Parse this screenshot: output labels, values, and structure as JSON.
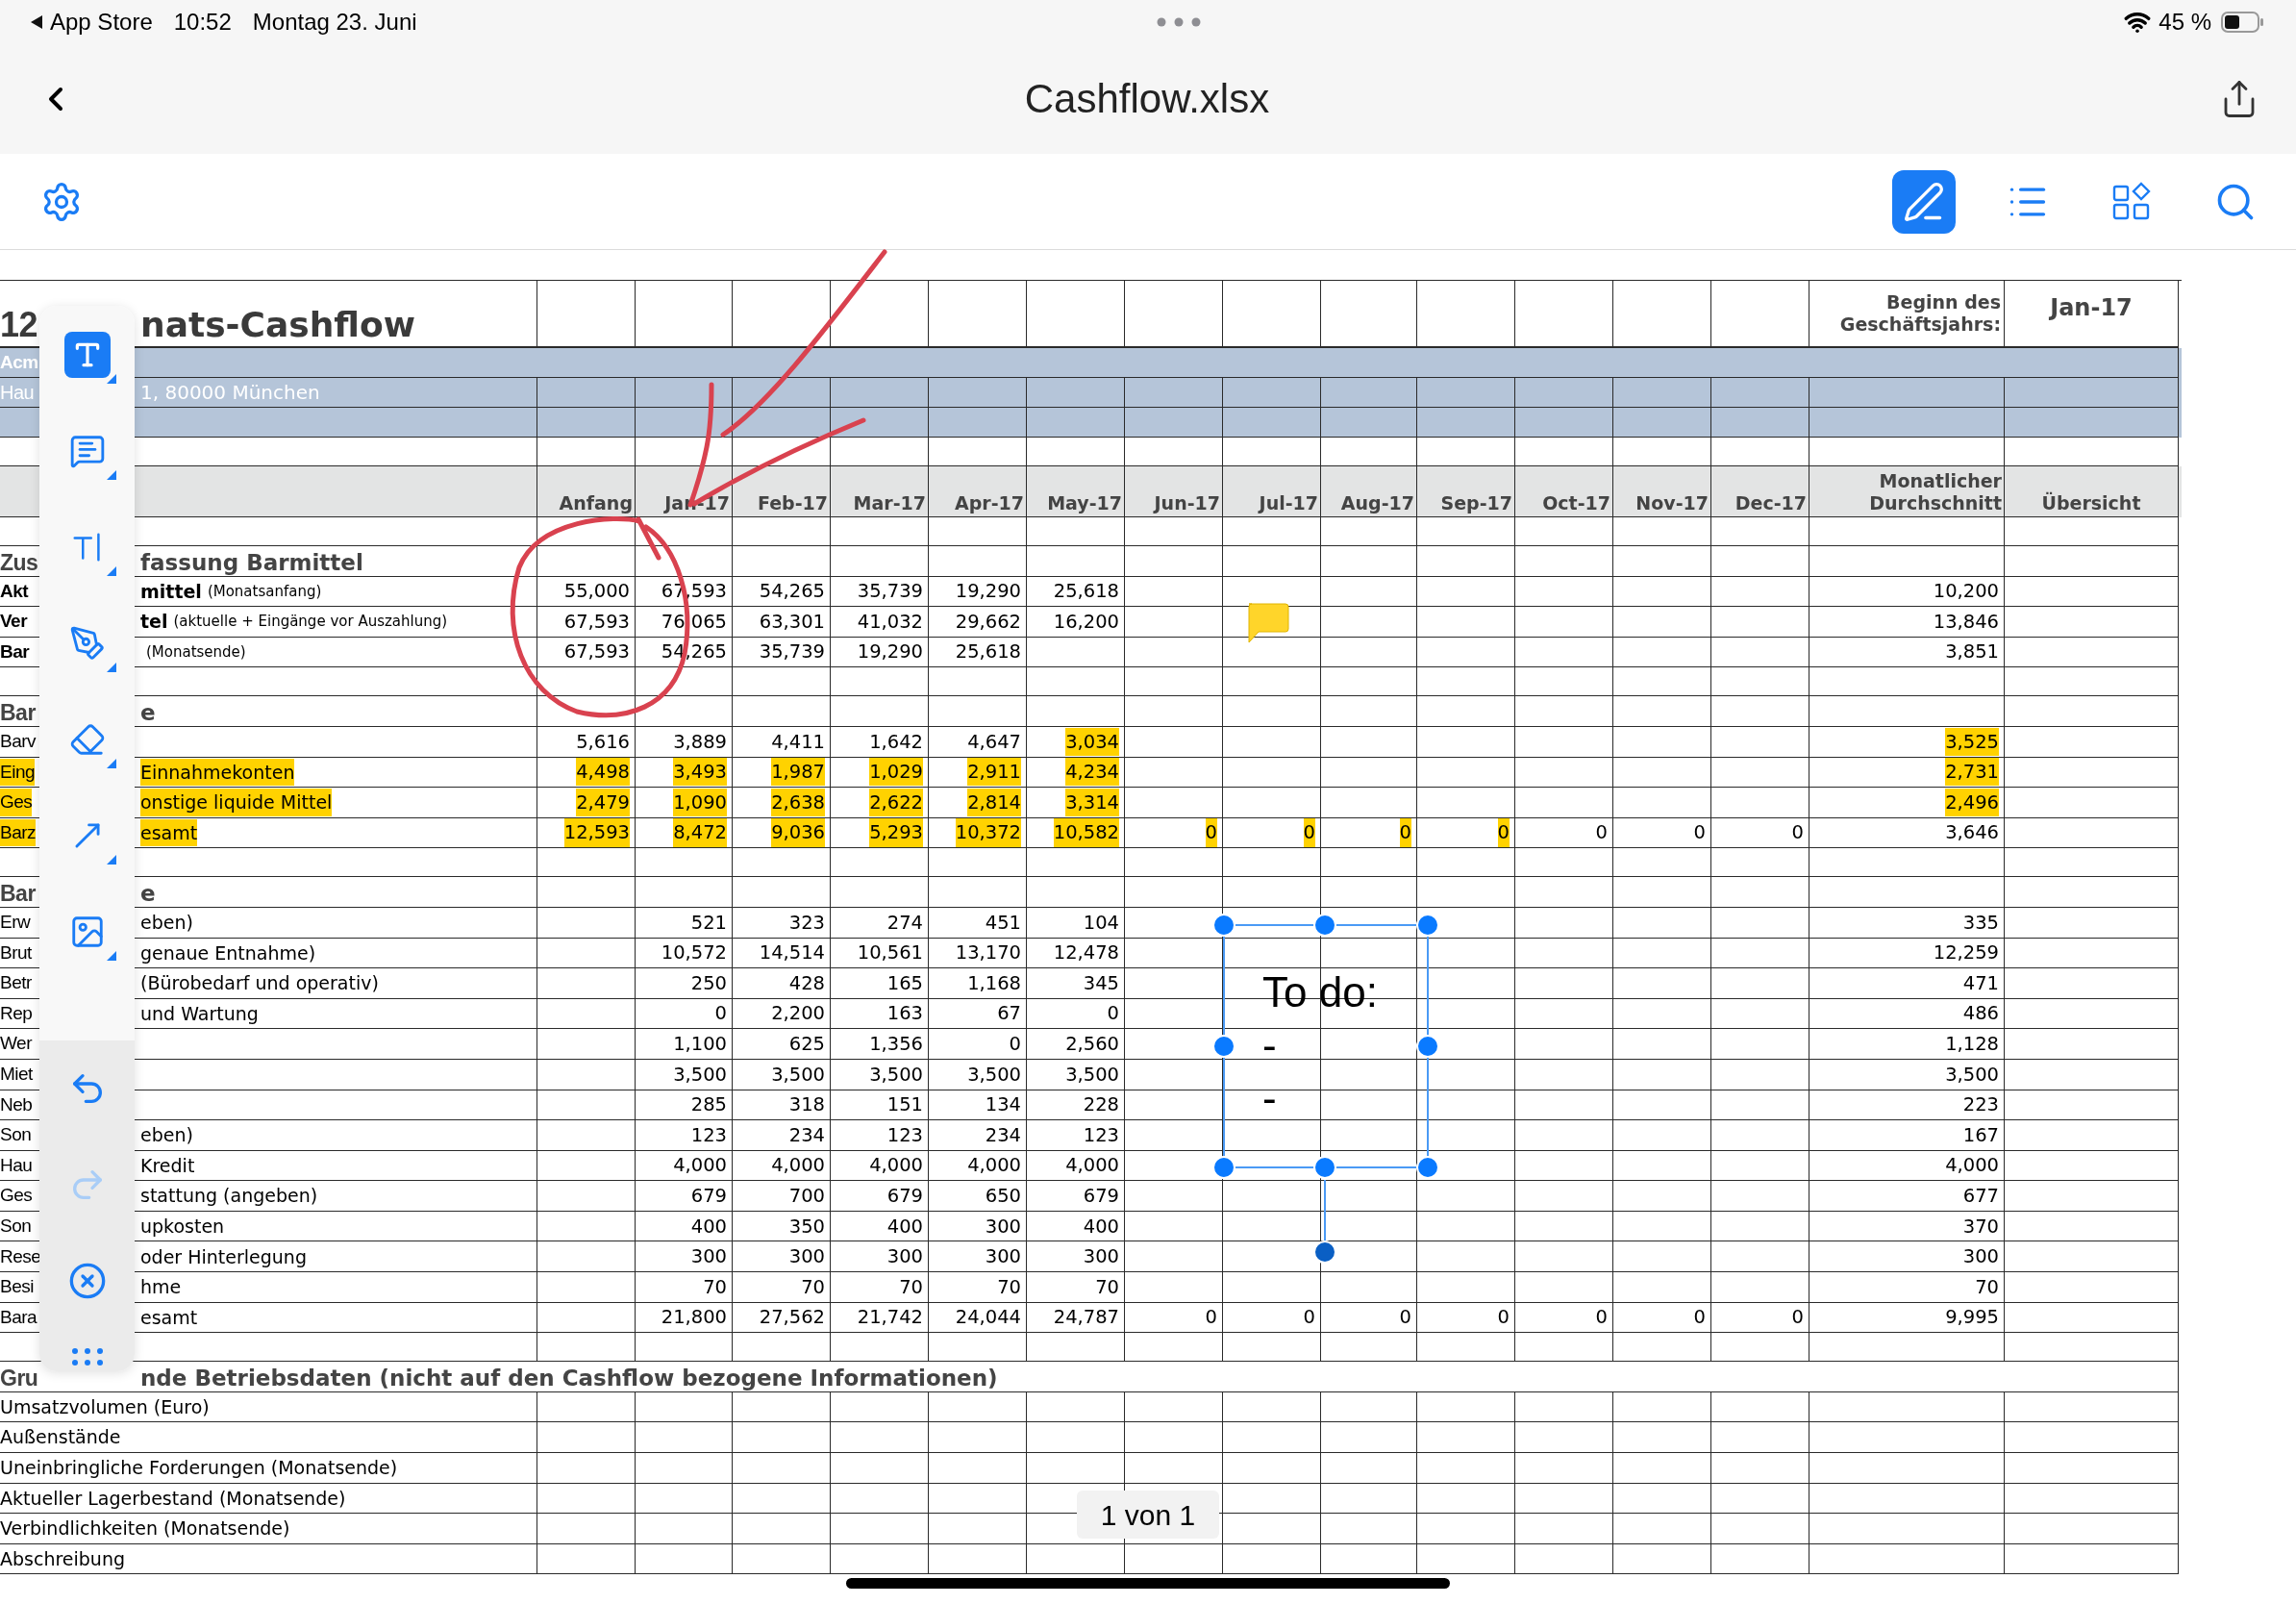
{
  "status_bar": {
    "app": "App Store",
    "time": "10:52",
    "date": "Montag 23. Juni",
    "battery": "45 %"
  },
  "nav": {
    "title": "Cashflow.xlsx"
  },
  "view_tools": [
    {
      "kind": "markup",
      "selected": true
    },
    {
      "kind": "outline",
      "selected": false
    },
    {
      "kind": "thumbnails",
      "selected": false
    },
    {
      "kind": "search",
      "selected": false
    }
  ],
  "annotation_tools": [
    {
      "kind": "text",
      "selected": true
    },
    {
      "kind": "comment",
      "selected": false
    },
    {
      "kind": "text_cursor",
      "selected": false
    },
    {
      "kind": "pen",
      "selected": false
    },
    {
      "kind": "eraser",
      "selected": false
    },
    {
      "kind": "arrow",
      "selected": false
    },
    {
      "kind": "image",
      "selected": false
    }
  ],
  "toolbar_actions": [
    {
      "kind": "undo",
      "disabled": false
    },
    {
      "kind": "redo",
      "disabled": true
    },
    {
      "kind": "close",
      "disabled": false
    },
    {
      "kind": "more",
      "disabled": false
    }
  ],
  "sheet": {
    "rows": [
      {
        "kind": "title",
        "label_start": "12",
        "label_end": "nats-Cashflow",
        "fiscal_label": "Beginn des Geschäftsjahrs:",
        "fiscal_value": "Jan-17"
      },
      {
        "kind": "band_title",
        "label_start": "Acm"
      },
      {
        "kind": "band",
        "label_start": "Hau",
        "label_end": "1, 80000 München"
      },
      {
        "kind": "band"
      },
      {
        "kind": "blank"
      },
      {
        "kind": "header",
        "columns": [
          "Anfang",
          "Jan-17",
          "Feb-17",
          "Mar-17",
          "Apr-17",
          "May-17",
          "Jun-17",
          "Jul-17",
          "Aug-17",
          "Sep-17",
          "Oct-17",
          "Nov-17",
          "Dec-17",
          "Monatlicher Durchschnitt",
          "Übersicht"
        ]
      },
      {
        "kind": "blank"
      },
      {
        "kind": "section",
        "label_start": "Zus",
        "label_end": "fassung Barmittel"
      },
      {
        "kind": "summary",
        "label_start": "Akt",
        "label_end": "mittel",
        "label_note": "(Monatsanfang)",
        "label_highlighted": false,
        "anfang": "55,000",
        "months": [
          "67,593",
          "54,265",
          "35,739",
          "19,290",
          "25,618"
        ],
        "average": "10,200"
      },
      {
        "kind": "summary",
        "label_start": "Ver",
        "label_end": "tel",
        "label_note": "(aktuelle + Eingänge vor Auszahlung)",
        "label_highlighted": false,
        "anfang": "67,593",
        "months": [
          "76,065",
          "63,301",
          "41,032",
          "29,662",
          "16,200"
        ],
        "average": "13,846"
      },
      {
        "kind": "summary",
        "label_start": "Bar",
        "label_note": "(Monatsende)",
        "label_highlighted": false,
        "anfang": "67,593",
        "months": [
          "54,265",
          "35,739",
          "19,290",
          "25,618"
        ],
        "average": "3,851"
      },
      {
        "kind": "blank"
      },
      {
        "kind": "section",
        "label_start": "Bar",
        "label_end": "e"
      },
      {
        "kind": "data",
        "label_start": "Barv",
        "label_highlighted": false,
        "anfang": {
          "text": "5,616",
          "highlighted": false
        },
        "months": [
          {
            "text": "3,889",
            "highlighted": false
          },
          {
            "text": "4,411",
            "highlighted": false
          },
          {
            "text": "1,642",
            "highlighted": false
          },
          {
            "text": "4,647",
            "highlighted": false
          },
          {
            "text": "3,034",
            "highlighted": true
          }
        ],
        "average": {
          "text": "3,525",
          "highlighted": true
        }
      },
      {
        "kind": "data",
        "label_start": "Eing",
        "label_end": "Einnahmekonten",
        "label_highlighted": true,
        "anfang": {
          "text": "4,498",
          "highlighted": true
        },
        "months": [
          {
            "text": "3,493",
            "highlighted": true
          },
          {
            "text": "1,987",
            "highlighted": true
          },
          {
            "text": "1,029",
            "highlighted": true
          },
          {
            "text": "2,911",
            "highlighted": true
          },
          {
            "text": "4,234",
            "highlighted": true
          }
        ],
        "average": {
          "text": "2,731",
          "highlighted": true
        }
      },
      {
        "kind": "data",
        "label_start": "Ges",
        "label_end": "onstige liquide Mittel",
        "label_highlighted": true,
        "anfang": {
          "text": "2,479",
          "highlighted": true
        },
        "months": [
          {
            "text": "1,090",
            "highlighted": true
          },
          {
            "text": "2,638",
            "highlighted": true
          },
          {
            "text": "2,622",
            "highlighted": true
          },
          {
            "text": "2,814",
            "highlighted": true
          },
          {
            "text": "3,314",
            "highlighted": true
          }
        ],
        "average": {
          "text": "2,496",
          "highlighted": true
        }
      },
      {
        "kind": "data",
        "label_start": "Barz",
        "label_end": "esamt",
        "label_highlighted": true,
        "anfang": {
          "text": "12,593",
          "highlighted": true
        },
        "months": [
          {
            "text": "8,472",
            "highlighted": true
          },
          {
            "text": "9,036",
            "highlighted": true
          },
          {
            "text": "5,293",
            "highlighted": true
          },
          {
            "text": "10,372",
            "highlighted": true
          },
          {
            "text": "10,582",
            "highlighted": true
          },
          {
            "text": "0",
            "highlighted": true
          },
          {
            "text": "0",
            "highlighted": true
          },
          {
            "text": "0",
            "highlighted": true
          },
          {
            "text": "0",
            "highlighted": true
          },
          {
            "text": "0",
            "highlighted": false
          },
          {
            "text": "0",
            "highlighted": false
          },
          {
            "text": "0",
            "highlighted": false
          }
        ],
        "average": {
          "text": "3,646",
          "highlighted": false
        }
      },
      {
        "kind": "blank"
      },
      {
        "kind": "section",
        "label_start": "Bar",
        "label_end": "e"
      },
      {
        "kind": "data",
        "label_start": "Erw",
        "label_end": "eben)",
        "label_highlighted": false,
        "months": [
          "521",
          "323",
          "274",
          "451",
          "104"
        ],
        "average": "335"
      },
      {
        "kind": "data",
        "label_start": "Brut",
        "label_end": "genaue Entnahme)",
        "label_highlighted": false,
        "months": [
          "10,572",
          "14,514",
          "10,561",
          "13,170",
          "12,478"
        ],
        "average": "12,259"
      },
      {
        "kind": "data",
        "label_start": "Betr",
        "label_end": "(Bürobedarf und operativ)",
        "label_highlighted": false,
        "months": [
          "250",
          "428",
          "165",
          "1,168",
          "345"
        ],
        "average": "471"
      },
      {
        "kind": "data",
        "label_start": "Rep",
        "label_end": "und Wartung",
        "label_highlighted": false,
        "months": [
          "0",
          "2,200",
          "163",
          "67",
          "0"
        ],
        "average": "486"
      },
      {
        "kind": "data",
        "label_start": "Wer",
        "label_highlighted": false,
        "months": [
          "1,100",
          "625",
          "1,356",
          "0",
          "2,560"
        ],
        "average": "1,128"
      },
      {
        "kind": "data",
        "label_start": "Miet",
        "label_highlighted": false,
        "months": [
          "3,500",
          "3,500",
          "3,500",
          "3,500",
          "3,500"
        ],
        "average": "3,500"
      },
      {
        "kind": "data",
        "label_start": "Neb",
        "label_highlighted": false,
        "months": [
          "285",
          "318",
          "151",
          "134",
          "228"
        ],
        "average": "223"
      },
      {
        "kind": "data",
        "label_start": "Son",
        "label_end": "eben)",
        "label_highlighted": false,
        "months": [
          "123",
          "234",
          "123",
          "234",
          "123"
        ],
        "average": "167"
      },
      {
        "kind": "data",
        "label_start": "Hau",
        "label_end": "Kredit",
        "label_highlighted": false,
        "months": [
          "4,000",
          "4,000",
          "4,000",
          "4,000",
          "4,000"
        ],
        "average": "4,000"
      },
      {
        "kind": "data",
        "label_start": "Ges",
        "label_end": "stattung (angeben)",
        "label_highlighted": false,
        "months": [
          "679",
          "700",
          "679",
          "650",
          "679"
        ],
        "average": "677"
      },
      {
        "kind": "data",
        "label_start": "Son",
        "label_end": "upkosten",
        "label_highlighted": false,
        "months": [
          "400",
          "350",
          "400",
          "300",
          "400"
        ],
        "average": "370"
      },
      {
        "kind": "data",
        "label_start": "Rese",
        "label_end": "oder Hinterlegung",
        "label_highlighted": false,
        "months": [
          "300",
          "300",
          "300",
          "300",
          "300"
        ],
        "average": "300"
      },
      {
        "kind": "data",
        "label_start": "Besi",
        "label_end": "hme",
        "label_highlighted": false,
        "months": [
          "70",
          "70",
          "70",
          "70",
          "70"
        ],
        "average": "70"
      },
      {
        "kind": "data",
        "label_start": "Bara",
        "label_end": "esamt",
        "label_highlighted": false,
        "months": [
          "21,800",
          "27,562",
          "21,742",
          "24,044",
          "24,787",
          "0",
          "0",
          "0",
          "0",
          "0",
          "0",
          "0"
        ],
        "average": "9,995"
      },
      {
        "kind": "blank"
      },
      {
        "kind": "section_wide",
        "label_start": "Gru",
        "label_end": "nde Betriebsdaten (nicht auf den Cashflow bezogene Informationen)"
      },
      {
        "kind": "data",
        "label": "Umsatzvolumen (Euro)",
        "label_highlighted": false
      },
      {
        "kind": "data",
        "label": "Außenstände",
        "label_highlighted": false
      },
      {
        "kind": "data",
        "label": "Uneinbringliche Forderungen (Monatsende)",
        "label_highlighted": false
      },
      {
        "kind": "data",
        "label": "Aktueller Lagerbestand (Monatsende)",
        "label_highlighted": false
      },
      {
        "kind": "data",
        "label": "Verbindlichkeiten (Monatsende)",
        "label_highlighted": false
      },
      {
        "kind": "data",
        "label": "Abschreibung",
        "label_highlighted": false
      }
    ]
  },
  "text_box": {
    "lines": [
      "To do:",
      "-",
      "-"
    ]
  },
  "page_indicator": "1 von 1"
}
